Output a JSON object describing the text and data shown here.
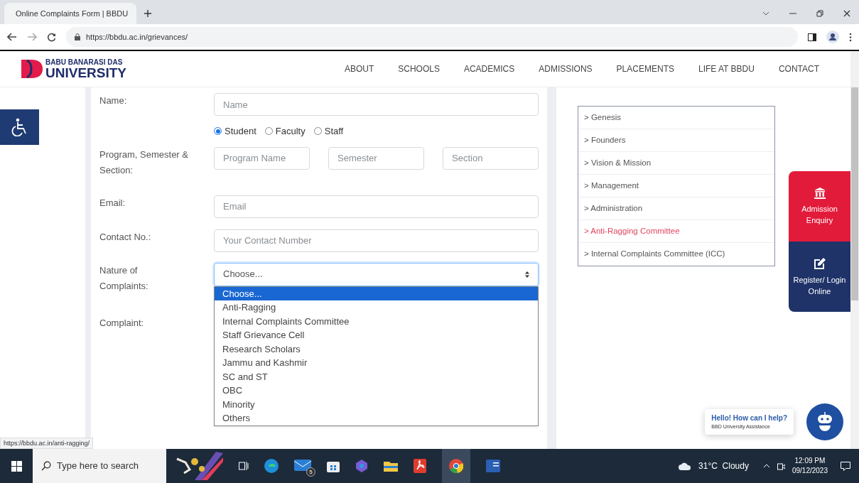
{
  "browser": {
    "tab_title": "Online Complaints Form | BBDU",
    "url": "https://bbdu.ac.in/grievances/",
    "status_url": "https://bbdu.ac.in/anti-ragging/"
  },
  "header": {
    "logo_top": "BABU BANARASI DAS",
    "logo_bottom": "UNIVERSITY",
    "nav": [
      "ABOUT",
      "SCHOOLS",
      "ACADEMICS",
      "ADMISSIONS",
      "PLACEMENTS",
      "LIFE AT BBDU",
      "CONTACT"
    ]
  },
  "form": {
    "name": {
      "label": "Name:",
      "placeholder": "Name"
    },
    "role": [
      {
        "label": "Student",
        "selected": true
      },
      {
        "label": "Faculty",
        "selected": false
      },
      {
        "label": "Staff",
        "selected": false
      }
    ],
    "program": {
      "label": "Program, Semester & Section:",
      "placeholders": [
        "Program Name",
        "Semester",
        "Section"
      ]
    },
    "email": {
      "label": "Email:",
      "placeholder": "Email"
    },
    "contact": {
      "label": "Contact No.:",
      "placeholder": "Your Contact Number"
    },
    "nature": {
      "label": "Nature of Complaints:",
      "value": "Choose...",
      "expanded": true,
      "options": [
        {
          "label": "Choose...",
          "selected": true
        },
        {
          "label": "Anti-Ragging",
          "selected": false
        },
        {
          "label": "Internal Complaints Committee",
          "selected": false
        },
        {
          "label": "Staff Grievance Cell",
          "selected": false
        },
        {
          "label": "Research Scholars",
          "selected": false
        },
        {
          "label": "Jammu and Kashmir",
          "selected": false
        },
        {
          "label": "SC and ST",
          "selected": false
        },
        {
          "label": "OBC",
          "selected": false
        },
        {
          "label": "Minority",
          "selected": false
        },
        {
          "label": "Others",
          "selected": false
        }
      ]
    },
    "complaint": {
      "label": "Complaint:"
    }
  },
  "sidebar": {
    "items": [
      {
        "label": "> Genesis",
        "selected": false
      },
      {
        "label": "> Founders",
        "selected": false
      },
      {
        "label": "> Vision & Mission",
        "selected": false
      },
      {
        "label": "> Management",
        "selected": false
      },
      {
        "label": "> Administration",
        "selected": false
      },
      {
        "label": "> Anti-Ragging Committee",
        "selected": true
      },
      {
        "label": "> Internal Complaints Committee (ICC)",
        "selected": false
      }
    ]
  },
  "side_buttons": [
    {
      "kind": "enquiry",
      "label": "Admission Enquiry"
    },
    {
      "kind": "register",
      "label": "Register/ Login Online"
    }
  ],
  "chat": {
    "title": "Hello! How can I help?",
    "subtitle": "BBD University Assistance"
  },
  "taskbar": {
    "search_placeholder": "Type here to search",
    "mail_badge": "5",
    "weather": "31°C  Cloudy",
    "time": "12:09 PM",
    "date": "09/12/2023"
  }
}
